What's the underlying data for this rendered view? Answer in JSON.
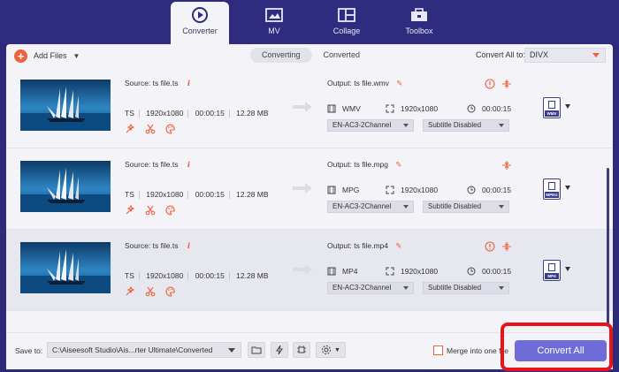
{
  "nav": {
    "tabs": [
      {
        "label": "Converter",
        "icon": "converter-icon",
        "active": true
      },
      {
        "label": "MV",
        "icon": "mv-icon",
        "active": false
      },
      {
        "label": "Collage",
        "icon": "collage-icon",
        "active": false
      },
      {
        "label": "Toolbox",
        "icon": "toolbox-icon",
        "active": false
      }
    ]
  },
  "toolbar": {
    "add_files_label": "Add Files",
    "converting_label": "Converting",
    "converted_label": "Converted",
    "convert_all_to_label": "Convert All to:",
    "format_value": "DIVX"
  },
  "files": [
    {
      "source": "Source: ts file.ts",
      "container": "TS",
      "resolution": "1920x1080",
      "duration": "00:00:15",
      "size": "12.28 MB",
      "output": "Output: ts file.wmv",
      "out_format": "WMV",
      "out_resolution": "1920x1080",
      "out_duration": "00:00:15",
      "audio": "EN-AC3-2Channel",
      "subtitle": "Subtitle Disabled",
      "badge": "WMV",
      "has_info_icon": true
    },
    {
      "source": "Source: ts file.ts",
      "container": "TS",
      "resolution": "1920x1080",
      "duration": "00:00:15",
      "size": "12.28 MB",
      "output": "Output: ts file.mpg",
      "out_format": "MPG",
      "out_resolution": "1920x1080",
      "out_duration": "00:00:15",
      "audio": "EN-AC3-2Channel",
      "subtitle": "Subtitle Disabled",
      "badge": "MPEG",
      "has_info_icon": false
    },
    {
      "source": "Source: ts file.ts",
      "container": "TS",
      "resolution": "1920x1080",
      "duration": "00:00:15",
      "size": "12.28 MB",
      "output": "Output: ts file.mp4",
      "out_format": "MP4",
      "out_resolution": "1920x1080",
      "out_duration": "00:00:15",
      "audio": "EN-AC3-2Channel",
      "subtitle": "Subtitle Disabled",
      "badge": "MP4",
      "has_info_icon": true
    }
  ],
  "bottom": {
    "save_to_label": "Save to:",
    "save_path": "C:\\Aiseesoft Studio\\Ais...rter Ultimate\\Converted",
    "merge_label": "Merge into one file",
    "convert_all_button": "Convert All"
  },
  "colors": {
    "accent": "#f0603a",
    "nav_bg": "#2f2b7e",
    "button": "#6e6dd8",
    "highlight": "#e8141c"
  }
}
